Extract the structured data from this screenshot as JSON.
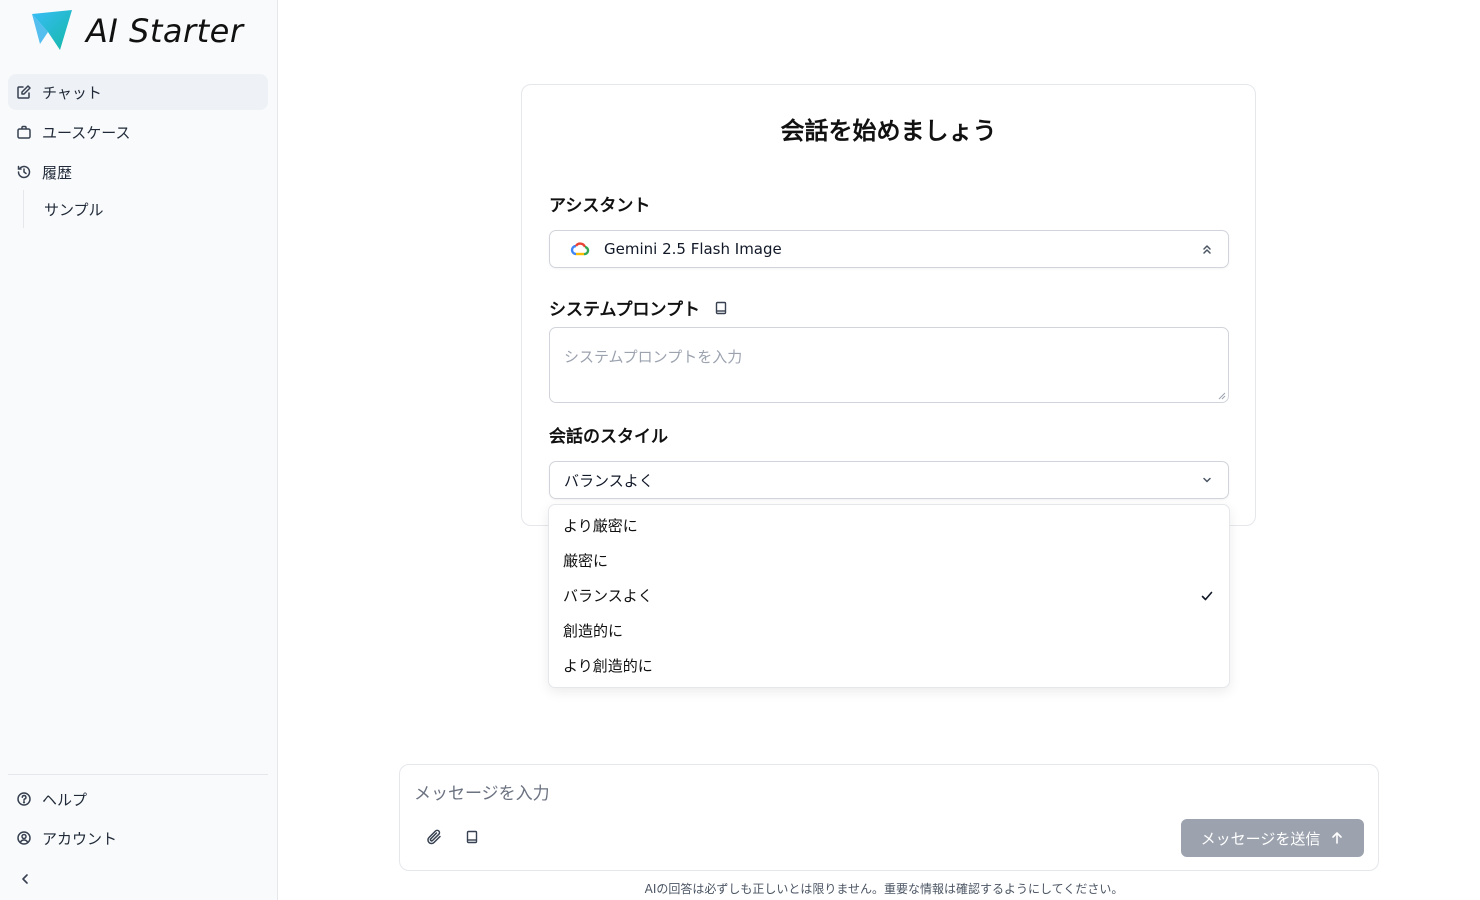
{
  "app": {
    "name": "AI Starter"
  },
  "sidebar": {
    "items": [
      {
        "label": "チャット",
        "icon": "edit-icon",
        "active": true
      },
      {
        "label": "ユースケース",
        "icon": "briefcase-icon",
        "active": false
      },
      {
        "label": "履歴",
        "icon": "history-icon",
        "active": false
      }
    ],
    "history_items": [
      "サンプル"
    ],
    "bottom_items": [
      {
        "label": "ヘルプ",
        "icon": "help-icon"
      },
      {
        "label": "アカウント",
        "icon": "account-icon"
      }
    ]
  },
  "main": {
    "title": "会話を始めましょう",
    "assistant": {
      "label": "アシスタント",
      "selected": "Gemini 2.5 Flash Image"
    },
    "system_prompt": {
      "label": "システムプロンプト",
      "placeholder": "システムプロンプトを入力"
    },
    "style": {
      "label": "会話のスタイル",
      "selected": "バランスよく",
      "options": [
        "より厳密に",
        "厳密に",
        "バランスよく",
        "創造的に",
        "より創造的に"
      ]
    }
  },
  "composer": {
    "placeholder": "メッセージを入力",
    "send_label": "メッセージを送信",
    "disclaimer": "AIの回答は必ずしも正しいとは限りません。重要な情報は確認するようにしてください。"
  },
  "colors": {
    "accent": "#0ea5e9",
    "send_disabled": "#9ca3af"
  }
}
